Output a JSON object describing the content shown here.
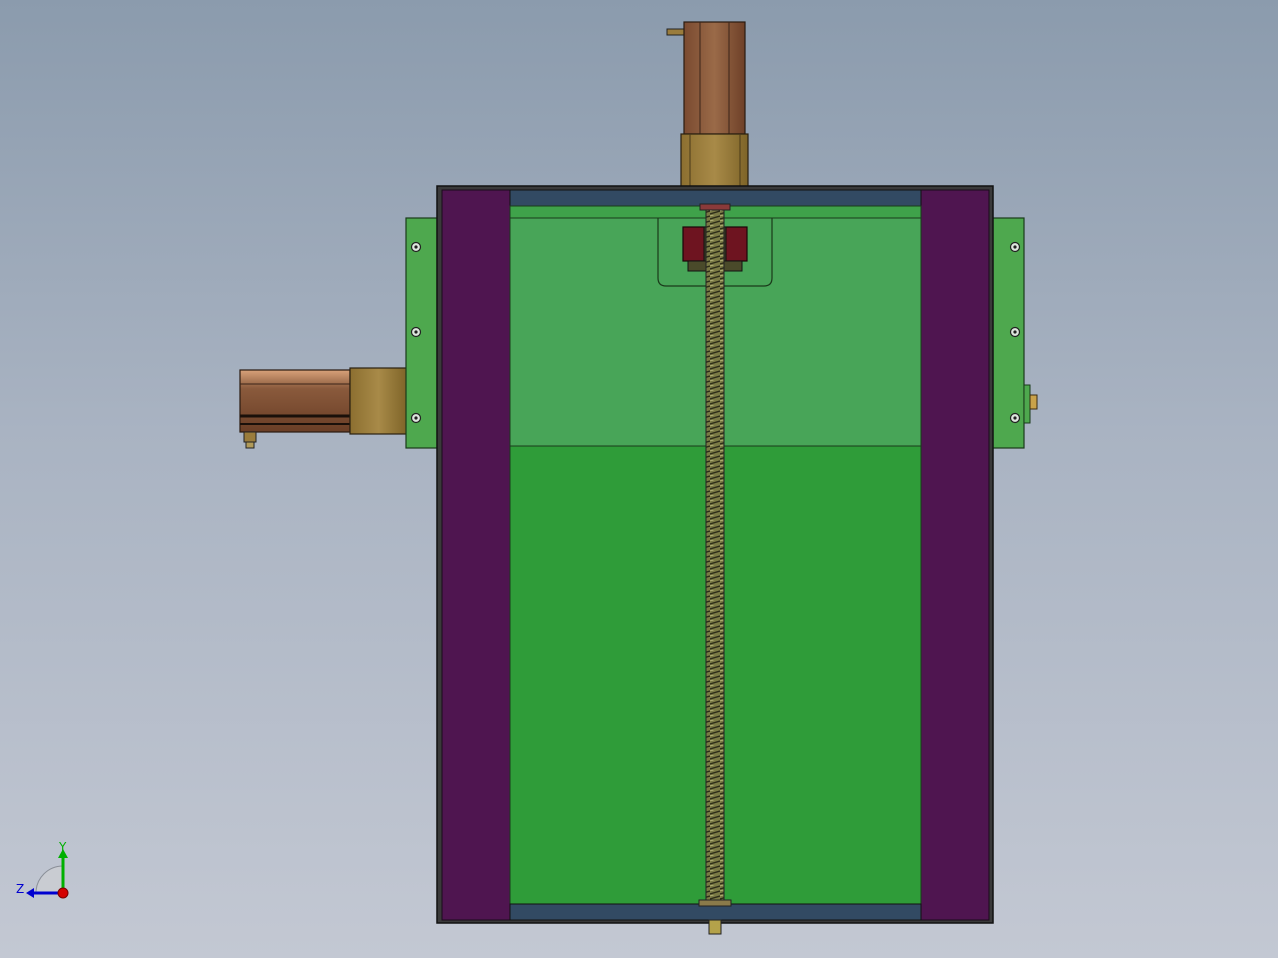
{
  "view": {
    "background_top": "#8b9bad",
    "background_bottom": "#c3c8d3"
  },
  "model": {
    "frame_color": "#2b2b2b",
    "side_rail_color": "#4f1550",
    "plate_upper_color": "#48a558",
    "plate_lower_color": "#2f9c39",
    "end_cap_color": "#324a63",
    "bracket_color": "#4ea84e",
    "motor_color": "#8a5a3c",
    "motor_adapter_color": "#9a7c3c",
    "nut_color": "#6e1420",
    "screw_color": "#6b6b3a"
  },
  "triad": {
    "x_label": "",
    "y_label": "Y",
    "z_label": "Z",
    "x_color": "#d40000",
    "y_color": "#00b000",
    "z_color": "#0000d0"
  }
}
